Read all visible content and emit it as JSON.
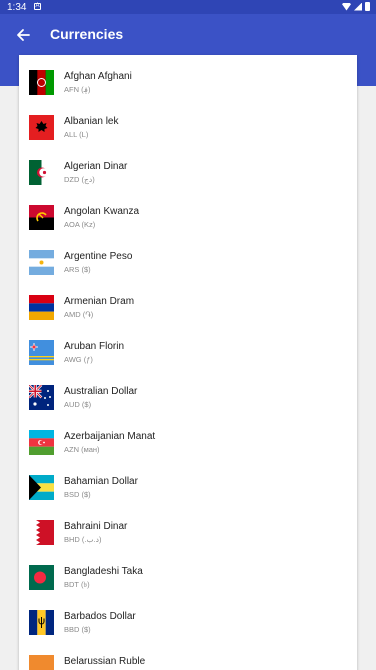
{
  "status_bar": {
    "time": "1:34",
    "notification_glyph": "A"
  },
  "app_bar": {
    "title": "Currencies",
    "back_icon": "arrow-left-icon"
  },
  "currencies": [
    {
      "name": "Afghan Afghani",
      "code": "AFN (؋)",
      "flag": "af"
    },
    {
      "name": "Albanian lek",
      "code": "ALL (L)",
      "flag": "al"
    },
    {
      "name": "Algerian Dinar",
      "code": "DZD (دج)",
      "flag": "dz"
    },
    {
      "name": "Angolan Kwanza",
      "code": "AOA (Kz)",
      "flag": "ao"
    },
    {
      "name": "Argentine Peso",
      "code": "ARS ($)",
      "flag": "ar"
    },
    {
      "name": "Armenian Dram",
      "code": "AMD (֏)",
      "flag": "am"
    },
    {
      "name": "Aruban Florin",
      "code": "AWG (ƒ)",
      "flag": "aw"
    },
    {
      "name": "Australian Dollar",
      "code": "AUD ($)",
      "flag": "au"
    },
    {
      "name": "Azerbaijanian Manat",
      "code": "AZN (ман)",
      "flag": "az"
    },
    {
      "name": "Bahamian Dollar",
      "code": "BSD ($)",
      "flag": "bs"
    },
    {
      "name": "Bahraini Dinar",
      "code": "BHD (.د.ب)",
      "flag": "bh"
    },
    {
      "name": "Bangladeshi Taka",
      "code": "BDT (৳)",
      "flag": "bd"
    },
    {
      "name": "Barbados Dollar",
      "code": "BBD ($)",
      "flag": "bb"
    },
    {
      "name": "Belarussian Ruble",
      "code": "",
      "flag": "by"
    }
  ],
  "colors": {
    "primary": "#3b52c6",
    "primary_dark": "#2f45b5",
    "background": "#f0f0f0"
  }
}
